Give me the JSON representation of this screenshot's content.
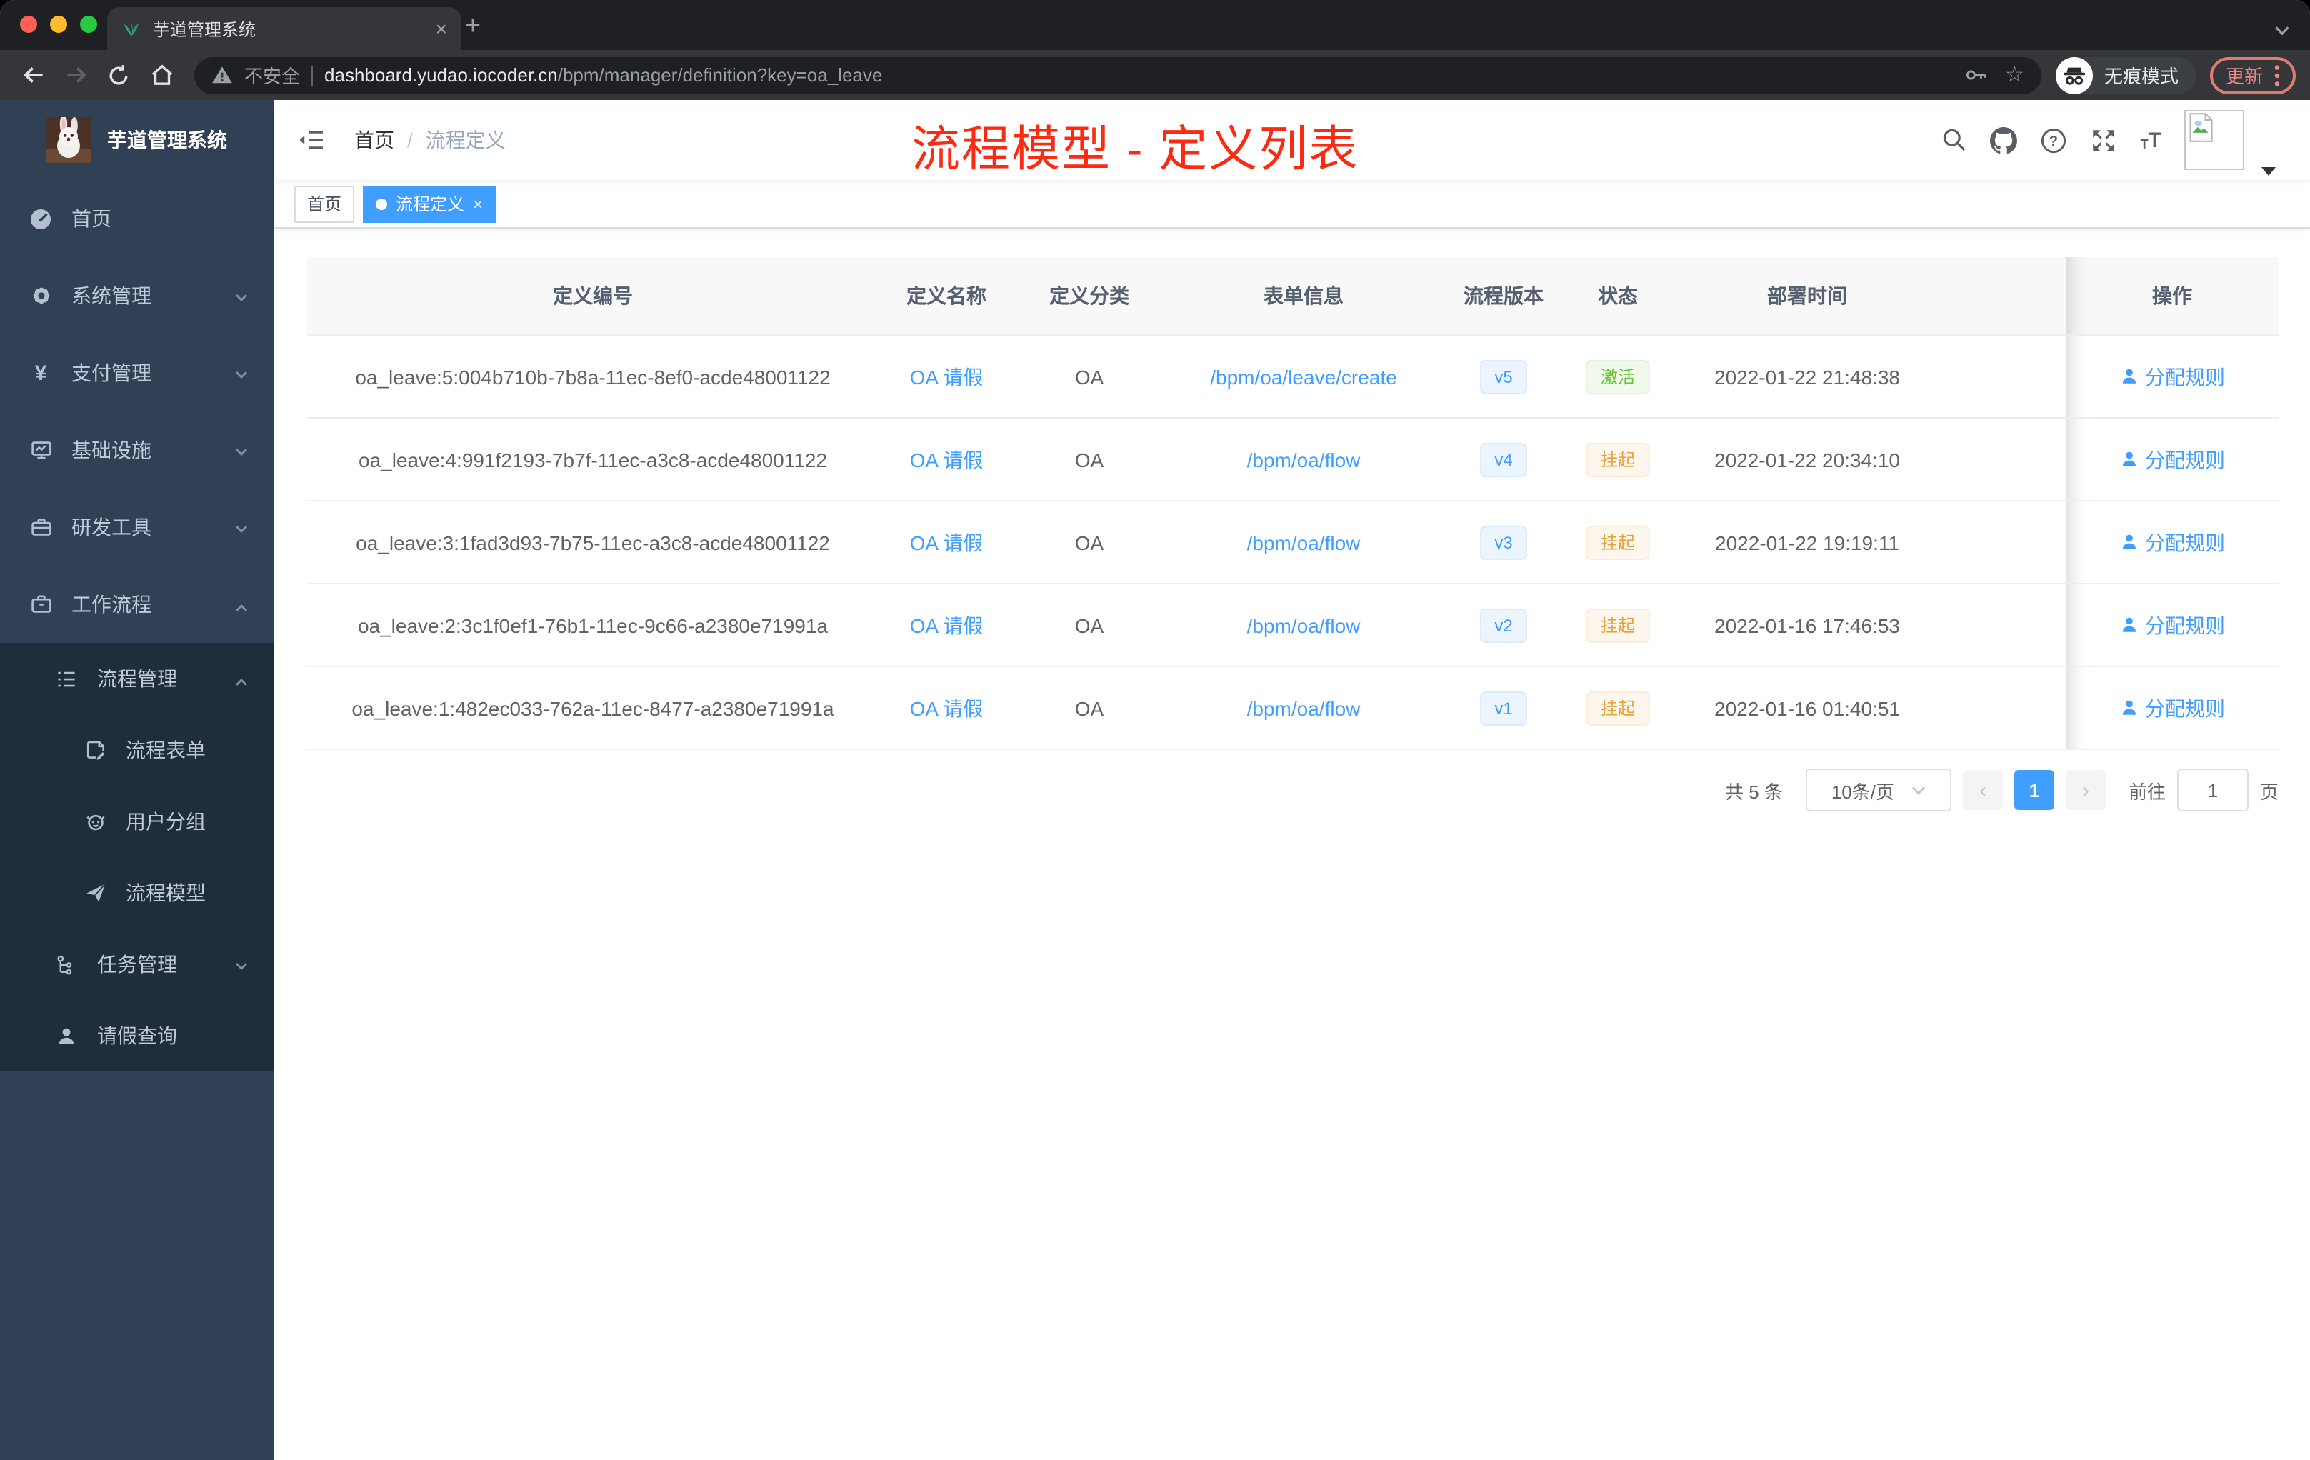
{
  "chrome": {
    "tab": {
      "title": "芋道管理系统"
    },
    "toolbar": {
      "security_label": "不安全",
      "url_domain": "dashboard.yudao.iocoder.cn",
      "url_path": "/bpm/manager/definition?key=oa_leave",
      "incognito_label": "无痕模式",
      "update_label": "更新"
    }
  },
  "icons": {
    "tab_close": "×",
    "new_tab": "+",
    "star": "☆",
    "prev_page": "‹",
    "next_page": "›",
    "font_small": "T",
    "font_big": "T",
    "yen": "¥"
  },
  "sidebar": {
    "app_title": "芋道管理系统",
    "items": [
      {
        "label": "首页"
      },
      {
        "label": "系统管理"
      },
      {
        "label": "支付管理"
      },
      {
        "label": "基础设施"
      },
      {
        "label": "研发工具"
      },
      {
        "label": "工作流程"
      }
    ],
    "workflow_submenu": [
      {
        "label": "流程管理"
      },
      {
        "label": "流程表单"
      },
      {
        "label": "用户分组"
      },
      {
        "label": "流程模型"
      },
      {
        "label": "任务管理"
      },
      {
        "label": "请假查询"
      }
    ]
  },
  "app_header": {
    "breadcrumb": {
      "home": "首页",
      "separator": "/",
      "current": "流程定义"
    },
    "annotation": "流程模型 - 定义列表"
  },
  "tags_view": {
    "home_tag": "首页",
    "active_tag": "流程定义"
  },
  "table": {
    "columns": [
      "定义编号",
      "定义名称",
      "定义分类",
      "表单信息",
      "流程版本",
      "状态",
      "部署时间",
      "操作"
    ],
    "rows": [
      {
        "id": "oa_leave:5:004b710b-7b8a-11ec-8ef0-acde48001122",
        "name": "OA 请假",
        "category": "OA",
        "form": "/bpm/oa/leave/create",
        "version": "v5",
        "status": "激活",
        "status_type": "active",
        "deploy_time": "2022-01-22 21:48:38",
        "action": "分配规则"
      },
      {
        "id": "oa_leave:4:991f2193-7b7f-11ec-a3c8-acde48001122",
        "name": "OA 请假",
        "category": "OA",
        "form": "/bpm/oa/flow",
        "version": "v4",
        "status": "挂起",
        "status_type": "suspended",
        "deploy_time": "2022-01-22 20:34:10",
        "action": "分配规则"
      },
      {
        "id": "oa_leave:3:1fad3d93-7b75-11ec-a3c8-acde48001122",
        "name": "OA 请假",
        "category": "OA",
        "form": "/bpm/oa/flow",
        "version": "v3",
        "status": "挂起",
        "status_type": "suspended",
        "deploy_time": "2022-01-22 19:19:11",
        "action": "分配规则"
      },
      {
        "id": "oa_leave:2:3c1f0ef1-76b1-11ec-9c66-a2380e71991a",
        "name": "OA 请假",
        "category": "OA",
        "form": "/bpm/oa/flow",
        "version": "v2",
        "status": "挂起",
        "status_type": "suspended",
        "deploy_time": "2022-01-16 17:46:53",
        "action": "分配规则"
      },
      {
        "id": "oa_leave:1:482ec033-762a-11ec-8477-a2380e71991a",
        "name": "OA 请假",
        "category": "OA",
        "form": "/bpm/oa/flow",
        "version": "v1",
        "status": "挂起",
        "status_type": "suspended",
        "deploy_time": "2022-01-16 01:40:51",
        "action": "分配规则"
      }
    ]
  },
  "pagination": {
    "total": "共 5 条",
    "page_size": "10条/页",
    "current_page": "1",
    "goto_label": "前往",
    "goto_page": "1",
    "page_unit": "页"
  },
  "colors": {
    "accent": "#409eff",
    "success": "#67c23a",
    "warning": "#e6a23c",
    "annotation_red": "#fb2b12",
    "sidebar_bg": "#304156",
    "submenu_bg": "#1f2d3d"
  }
}
